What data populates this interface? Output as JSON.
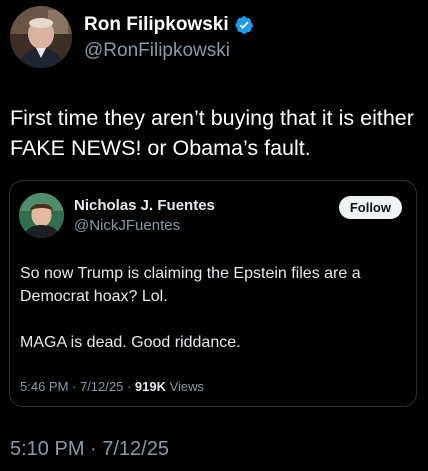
{
  "post": {
    "author": {
      "display_name": "Ron Filipkowski",
      "handle": "@RonFilipkowski",
      "verified": true,
      "verified_color": "#1d9bf0",
      "avatar_icon": "user-avatar-photo"
    },
    "text": "First time they aren’t buying that it is either FAKE NEWS! or Obama’s fault.",
    "timestamp": "5:10 PM · 7/12/25"
  },
  "quoted_post": {
    "author": {
      "display_name": "Nicholas J. Fuentes",
      "handle": "@NickJFuentes",
      "avatar_icon": "user-avatar-photo"
    },
    "follow_label": "Follow",
    "paragraphs": [
      "So now Trump is claiming the Epstein files are a Democrat hoax? Lol.",
      "MAGA is dead. Good riddance."
    ],
    "meta": {
      "time": "5:46 PM · 7/12/25 · ",
      "views_count": "919K",
      "views_label": " Views"
    }
  },
  "colors": {
    "background": "#000000",
    "primary_text": "#e7e9ea",
    "secondary_text": "#8b98a5",
    "card_border": "#2f3336",
    "follow_button_bg": "#eff3f4"
  }
}
